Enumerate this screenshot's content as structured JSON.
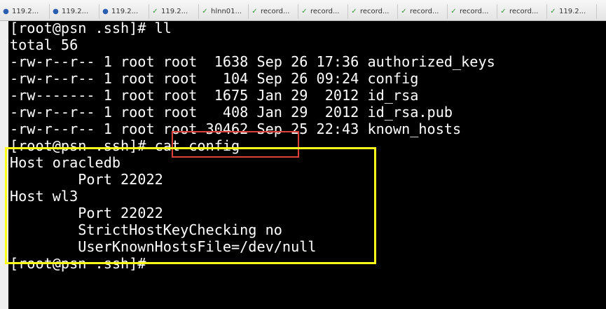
{
  "tabs": [
    {
      "label": "119.2...",
      "icon": "info-icon"
    },
    {
      "label": "119.2...",
      "icon": "info-icon"
    },
    {
      "label": "119.2...",
      "icon": "info-icon"
    },
    {
      "label": "119.2...",
      "icon": "check-icon"
    },
    {
      "label": "hlnn01...",
      "icon": "check-icon"
    },
    {
      "label": "record...",
      "icon": "check-icon"
    },
    {
      "label": "record...",
      "icon": "check-icon"
    },
    {
      "label": "record...",
      "icon": "check-icon"
    },
    {
      "label": "record...",
      "icon": "check-icon"
    },
    {
      "label": "record...",
      "icon": "check-icon"
    },
    {
      "label": "record...",
      "icon": "check-icon"
    },
    {
      "label": "119.2...",
      "icon": "check-icon"
    }
  ],
  "terminal": {
    "lines": [
      "[root@psn .ssh]# ll",
      "total 56",
      "-rw-r--r-- 1 root root  1638 Sep 26 17:36 authorized_keys",
      "-rw-r--r-- 1 root root   104 Sep 26 09:24 config",
      "-rw------- 1 root root  1675 Jan 29  2012 id_rsa",
      "-rw-r--r-- 1 root root   408 Jan 29  2012 id_rsa.pub",
      "-rw-r--r-- 1 root root 30462 Sep 25 22:43 known_hosts",
      "[root@psn .ssh]# cat config",
      "Host oracledb",
      "        Port 22022",
      "Host wl3",
      "        Port 22022",
      "        StrictHostKeyChecking no",
      "        UserKnownHostsFile=/dev/null",
      "[root@psn .ssh]#"
    ]
  },
  "colors": {
    "terminal_bg": "#000000",
    "terminal_fg": "#ffffff",
    "command_highlight": "#e0403a",
    "output_highlight": "#ffff1a"
  }
}
